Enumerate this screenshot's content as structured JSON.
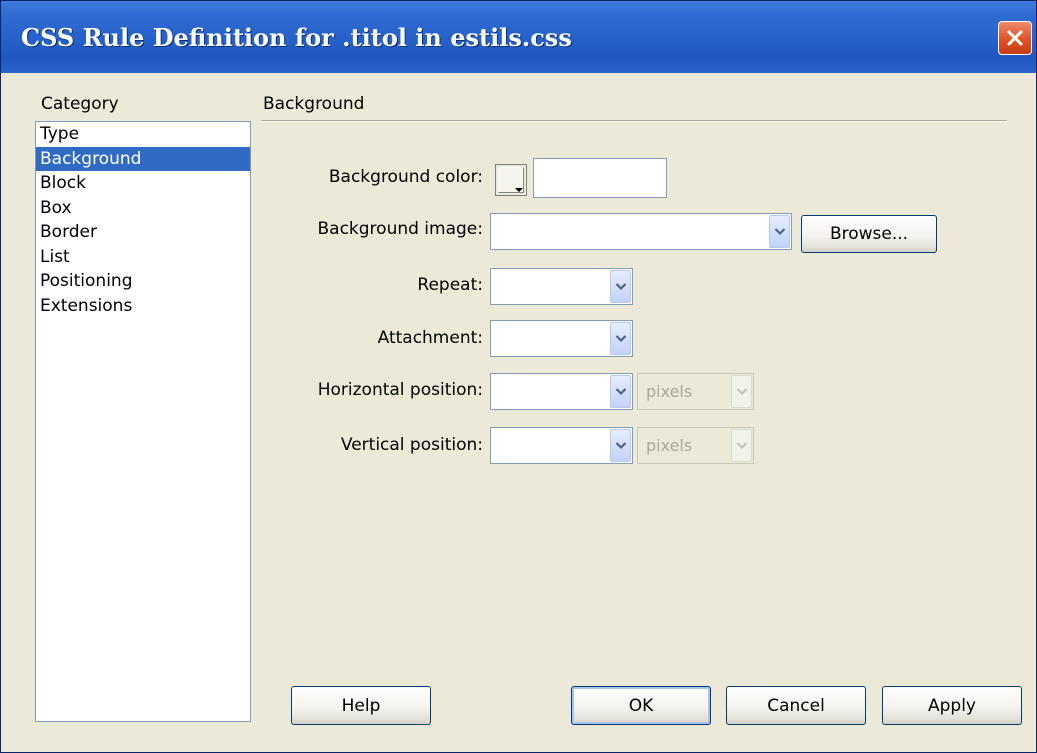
{
  "window": {
    "title": "CSS Rule Definition for .titol in estils.css"
  },
  "category": {
    "heading": "Category",
    "items": [
      "Type",
      "Background",
      "Block",
      "Box",
      "Border",
      "List",
      "Positioning",
      "Extensions"
    ],
    "selected": "Background"
  },
  "panel": {
    "heading": "Background",
    "bg_color_label": "Background color:",
    "bg_color_value": "",
    "bg_image_label": "Background image:",
    "bg_image_value": "",
    "browse_label": "Browse...",
    "repeat_label": "Repeat:",
    "repeat_value": "",
    "attachment_label": "Attachment:",
    "attachment_value": "",
    "hpos_label": "Horizontal position:",
    "hpos_value": "",
    "hpos_unit": "pixels",
    "vpos_label": "Vertical position:",
    "vpos_value": "",
    "vpos_unit": "pixels"
  },
  "buttons": {
    "help": "Help",
    "ok": "OK",
    "cancel": "Cancel",
    "apply": "Apply"
  },
  "colors": {
    "titlebar": "#2561c8",
    "selection": "#316ac5",
    "dialog_bg": "#ece9d8"
  },
  "icons": {
    "close": "close-icon",
    "dropdown": "chevron-down-icon",
    "color_picker": "color-picker-icon"
  }
}
